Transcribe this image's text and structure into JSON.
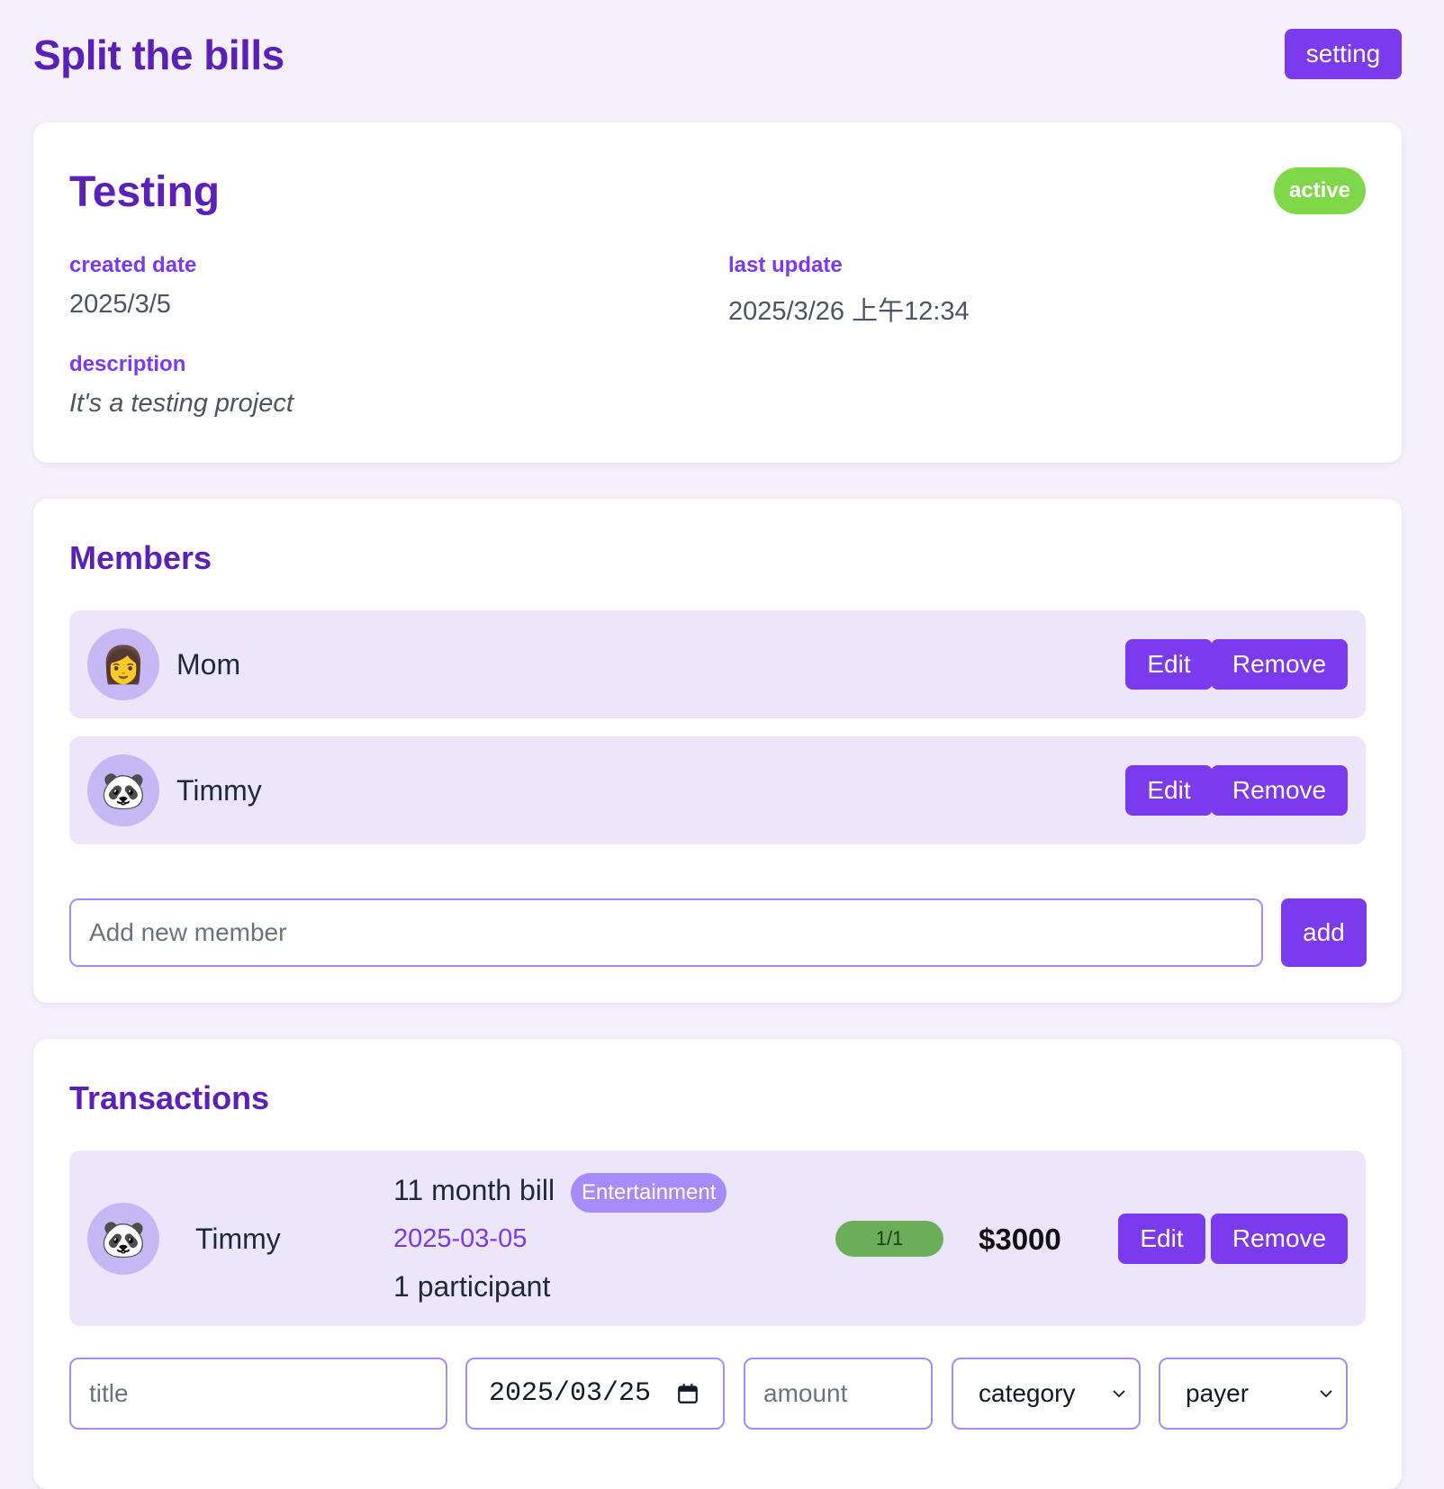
{
  "app": {
    "title": "Split the bills",
    "setting_label": "setting"
  },
  "project": {
    "name": "Testing",
    "status": "active",
    "status_color": "#7fd84a",
    "created_label": "created date",
    "created_value": "2025/3/5",
    "updated_label": "last update",
    "updated_value": "2025/3/26 上午12:34",
    "description_label": "description",
    "description_value": "It's a testing project"
  },
  "members": {
    "title": "Members",
    "items": [
      {
        "name": "Mom",
        "avatar": "👩",
        "avatar_icon": "woman-icon",
        "edit_label": "Edit",
        "remove_label": "Remove"
      },
      {
        "name": "Timmy",
        "avatar": "🐼",
        "avatar_icon": "panda-icon",
        "edit_label": "Edit",
        "remove_label": "Remove"
      }
    ],
    "add_placeholder": "Add new member",
    "add_value": "",
    "add_label": "add"
  },
  "transactions": {
    "title": "Transactions",
    "items": [
      {
        "payer": "Timmy",
        "avatar": "🐼",
        "avatar_icon": "panda-icon",
        "title": "11 month bill",
        "category": "Entertainment",
        "date": "2025-03-05",
        "participants": "1 participant",
        "progress": "1/1",
        "amount": "$3000",
        "edit_label": "Edit",
        "remove_label": "Remove"
      }
    ],
    "form": {
      "title_placeholder": "title",
      "title_value": "",
      "date_value": "2025/03/25",
      "amount_placeholder": "amount",
      "amount_value": "",
      "category_selected": "category",
      "payer_selected": "payer"
    }
  },
  "colors": {
    "accent": "#7c3aed",
    "heading": "#5b21b6",
    "background": "#f4f1fc",
    "row_background": "#ebe6fa",
    "avatar_background": "#c6b8f4",
    "category_badge": "#a78bfa",
    "progress_complete": "#6aae5a"
  }
}
